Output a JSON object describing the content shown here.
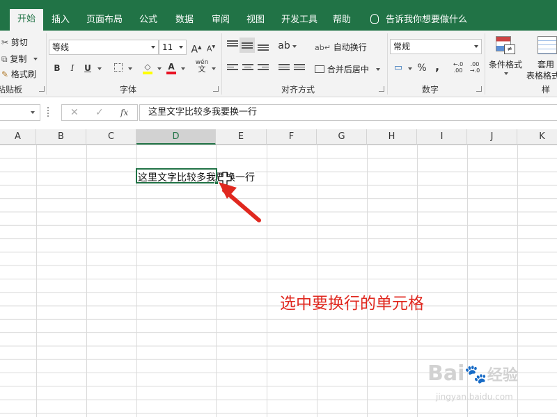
{
  "tabs": [
    {
      "label": "开始",
      "active": true
    },
    {
      "label": "插入"
    },
    {
      "label": "页面布局"
    },
    {
      "label": "公式"
    },
    {
      "label": "数据"
    },
    {
      "label": "审阅"
    },
    {
      "label": "视图"
    },
    {
      "label": "开发工具"
    },
    {
      "label": "帮助"
    }
  ],
  "tell_me": "告诉我你想要做什么",
  "clipboard": {
    "cut": "剪切",
    "copy": "复制",
    "format_painter": "格式刷",
    "group_label": "粘贴板"
  },
  "font": {
    "name": "等线",
    "size": "11",
    "bold": "B",
    "italic": "I",
    "underline": "U",
    "grow": "A",
    "shrink": "A",
    "wen": "wén",
    "wen_char": "文",
    "group_label": "字体"
  },
  "alignment": {
    "wrap_text": "自动换行",
    "merge_center": "合并后居中",
    "group_label": "对齐方式"
  },
  "number": {
    "format": "常规",
    "percent": "%",
    "comma": ",",
    "group_label": "数字"
  },
  "styles": {
    "conditional": "条件格式",
    "table_format_1": "套用",
    "table_format_2": "表格格式",
    "group_label": "样式"
  },
  "formula_bar": {
    "cancel": "✕",
    "enter": "✓",
    "fx": "fx",
    "content": "这里文字比较多我要换一行"
  },
  "columns": [
    "A",
    "B",
    "C",
    "D",
    "E",
    "F",
    "G",
    "H",
    "I",
    "J",
    "K"
  ],
  "selected_column": "D",
  "cell_text": "这里文字比较多我要换一行",
  "annotation": "选中要换行的单元格",
  "watermark": {
    "line1": "Bai",
    "line1b": "经验",
    "line2": "jingyan.baidu.com"
  },
  "colors": {
    "excel_green": "#217346",
    "annotation_red": "#e0281f"
  }
}
